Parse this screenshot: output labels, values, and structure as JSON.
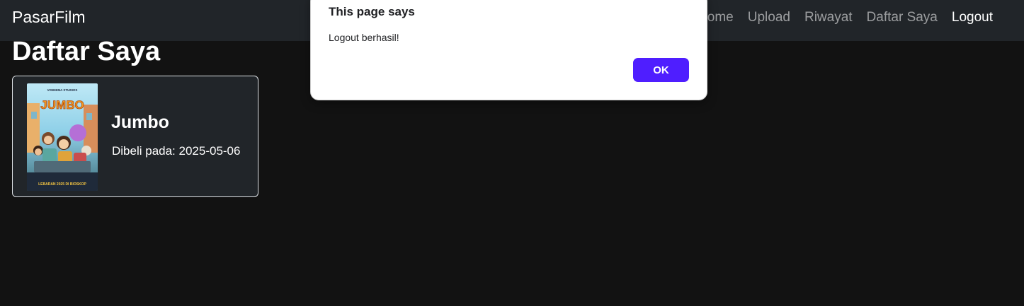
{
  "navbar": {
    "brand": "PasarFilm",
    "links": [
      {
        "label": "Home"
      },
      {
        "label": "Upload"
      },
      {
        "label": "Riwayat"
      },
      {
        "label": "Daftar Saya"
      },
      {
        "label": "Logout"
      }
    ]
  },
  "main": {
    "page_title": "Daftar Saya",
    "cards": [
      {
        "title": "Jumbo",
        "purchased_text": "Dibeli pada: 2025-05-06",
        "poster_title": "JUMBO",
        "poster_footer": "LEBARAN 2025 DI BIOSKOP"
      }
    ]
  },
  "dialog": {
    "title": "This page says",
    "message": "Logout berhasil!",
    "ok_label": "OK"
  },
  "colors": {
    "page_background": "#121212",
    "navbar_background": "#212529",
    "accent_button": "#4f1eff"
  }
}
